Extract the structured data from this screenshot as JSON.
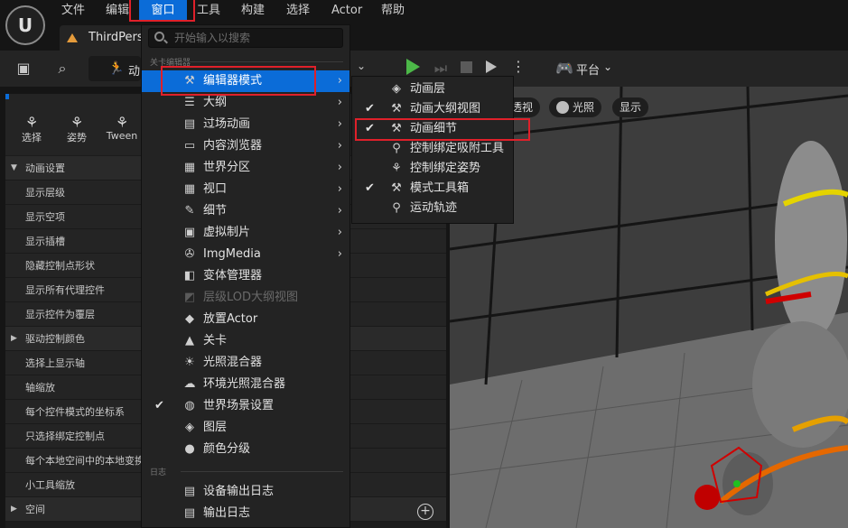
{
  "menubar": {
    "items": [
      "文件",
      "编辑",
      "窗口",
      "工具",
      "构建",
      "选择",
      "Actor",
      "帮助"
    ]
  },
  "tab": {
    "title": "ThirdPers"
  },
  "toolbar": {
    "mode_label": "动",
    "platform_label": "平台"
  },
  "left_panel": {
    "modes": [
      {
        "label": "选择",
        "icon": "select-icon"
      },
      {
        "label": "姿势",
        "icon": "pose-icon"
      },
      {
        "label": "Tween",
        "icon": "tween-icon"
      }
    ],
    "rows": [
      {
        "label": "动画设置",
        "section": true,
        "expanded": true
      },
      {
        "label": "显示层级"
      },
      {
        "label": "显示空项"
      },
      {
        "label": "显示插槽"
      },
      {
        "label": "隐藏控制点形状"
      },
      {
        "label": "显示所有代理控件"
      },
      {
        "label": "显示控件为覆层"
      },
      {
        "label": "驱动控制颜色",
        "section": true,
        "expanded": false
      },
      {
        "label": "选择上显示轴"
      },
      {
        "label": "轴缩放"
      },
      {
        "label": "每个控件模式的坐标系"
      },
      {
        "label": "只选择绑定控制点"
      },
      {
        "label": "每个本地空间中的本地变换"
      },
      {
        "label": "小工具缩放"
      },
      {
        "label": "空间",
        "section": true,
        "expanded": false
      }
    ]
  },
  "viewport": {
    "buttons": [
      "透视",
      "光照",
      "显示"
    ]
  },
  "window_menu": {
    "search_placeholder": "开始输入以搜索",
    "section_level_editor": "关卡编辑器",
    "section_log": "日志",
    "items": [
      {
        "label": "编辑器模式",
        "icon": "hammer-icon",
        "submenu": true,
        "highlighted": true
      },
      {
        "label": "大纲",
        "icon": "outliner-icon",
        "submenu": true
      },
      {
        "label": "过场动画",
        "icon": "clapper-icon",
        "submenu": true
      },
      {
        "label": "内容浏览器",
        "icon": "folder-icon",
        "submenu": true
      },
      {
        "label": "世界分区",
        "icon": "grid-icon",
        "submenu": true
      },
      {
        "label": "视口",
        "icon": "viewport-icon",
        "submenu": true
      },
      {
        "label": "细节",
        "icon": "details-icon",
        "submenu": true
      },
      {
        "label": "虚拟制片",
        "icon": "camera-icon",
        "submenu": true
      },
      {
        "label": "ImgMedia",
        "icon": "film-reel-icon",
        "submenu": true
      },
      {
        "label": "变体管理器",
        "icon": "variant-icon"
      },
      {
        "label": "层级LOD大纲视图",
        "icon": "lod-icon",
        "disabled": true
      },
      {
        "label": "放置Actor",
        "icon": "place-actor-icon"
      },
      {
        "label": "关卡",
        "icon": "level-icon"
      },
      {
        "label": "光照混合器",
        "icon": "light-mixer-icon"
      },
      {
        "label": "环境光照混合器",
        "icon": "env-light-icon"
      },
      {
        "label": "世界场景设置",
        "icon": "globe-icon",
        "checked": true
      },
      {
        "label": "图层",
        "icon": "layers-icon"
      },
      {
        "label": "颜色分级",
        "icon": "color-grade-icon"
      }
    ],
    "log_items": [
      {
        "label": "设备输出日志",
        "icon": "device-log-icon"
      },
      {
        "label": "输出日志",
        "icon": "output-log-icon"
      }
    ]
  },
  "editor_mode_submenu": {
    "items": [
      {
        "label": "动画层",
        "icon": "anim-layer-icon"
      },
      {
        "label": "动画大纲视图",
        "icon": "hammer-icon",
        "checked": true
      },
      {
        "label": "动画细节",
        "icon": "hammer-icon",
        "checked": true,
        "highlighted": true
      },
      {
        "label": "控制绑定吸附工具",
        "icon": "snap-icon"
      },
      {
        "label": "控制绑定姿势",
        "icon": "pose-icon"
      },
      {
        "label": "模式工具箱",
        "icon": "hammer-icon",
        "checked": true
      },
      {
        "label": "运动轨迹",
        "icon": "motion-trail-icon"
      }
    ]
  },
  "colors": {
    "accent_blue": "#0b6cd8",
    "highlight_red": "#e0202a",
    "menu_bg": "#232323",
    "panel_bg": "#242424"
  }
}
